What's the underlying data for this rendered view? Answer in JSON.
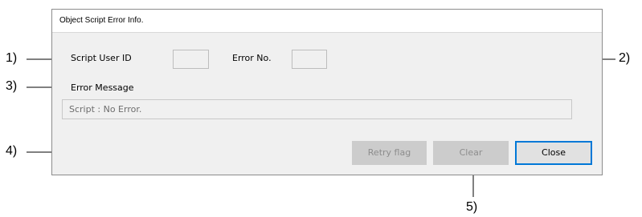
{
  "dialog": {
    "title": "Object Script Error Info.",
    "script_user_id_label": "Script User ID",
    "script_user_id_value": "",
    "error_no_label": "Error No.",
    "error_no_value": "",
    "error_message_label": "Error Message",
    "error_message_value": "Script : No Error.",
    "buttons": {
      "retry_flag": "Retry flag",
      "clear": "Clear",
      "close": "Close"
    }
  },
  "callouts": [
    "1)",
    "2)",
    "3)",
    "4)",
    "5)"
  ],
  "colors": {
    "dialog_bg": "#f0f0f0",
    "disabled_button": "#cccccc",
    "focus_border": "#0078d7"
  }
}
